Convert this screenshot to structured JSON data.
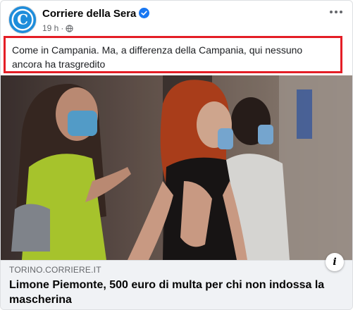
{
  "post": {
    "page_name": "Corriere della Sera",
    "time": "19 h",
    "separator": "·",
    "caption": "Come in Campania. Ma, a differenza della Campania, qui nessuno ancora ha trasgredito"
  },
  "link": {
    "domain": "TORINO.CORRIERE.IT",
    "headline": "Limone Piemonte, 500 euro di multa per chi non indossa la mascherina",
    "info_label": "i"
  },
  "icons": {
    "avatar": "corriere-logo-icon",
    "verified": "verified-badge-icon",
    "privacy": "globe-icon",
    "more": "more-options-icon",
    "info": "info-icon"
  },
  "colors": {
    "highlight_border": "#e41e26",
    "verified_blue": "#1877f2",
    "avatar_blue": "#1e8ddb",
    "link_bg": "#f0f2f5"
  }
}
